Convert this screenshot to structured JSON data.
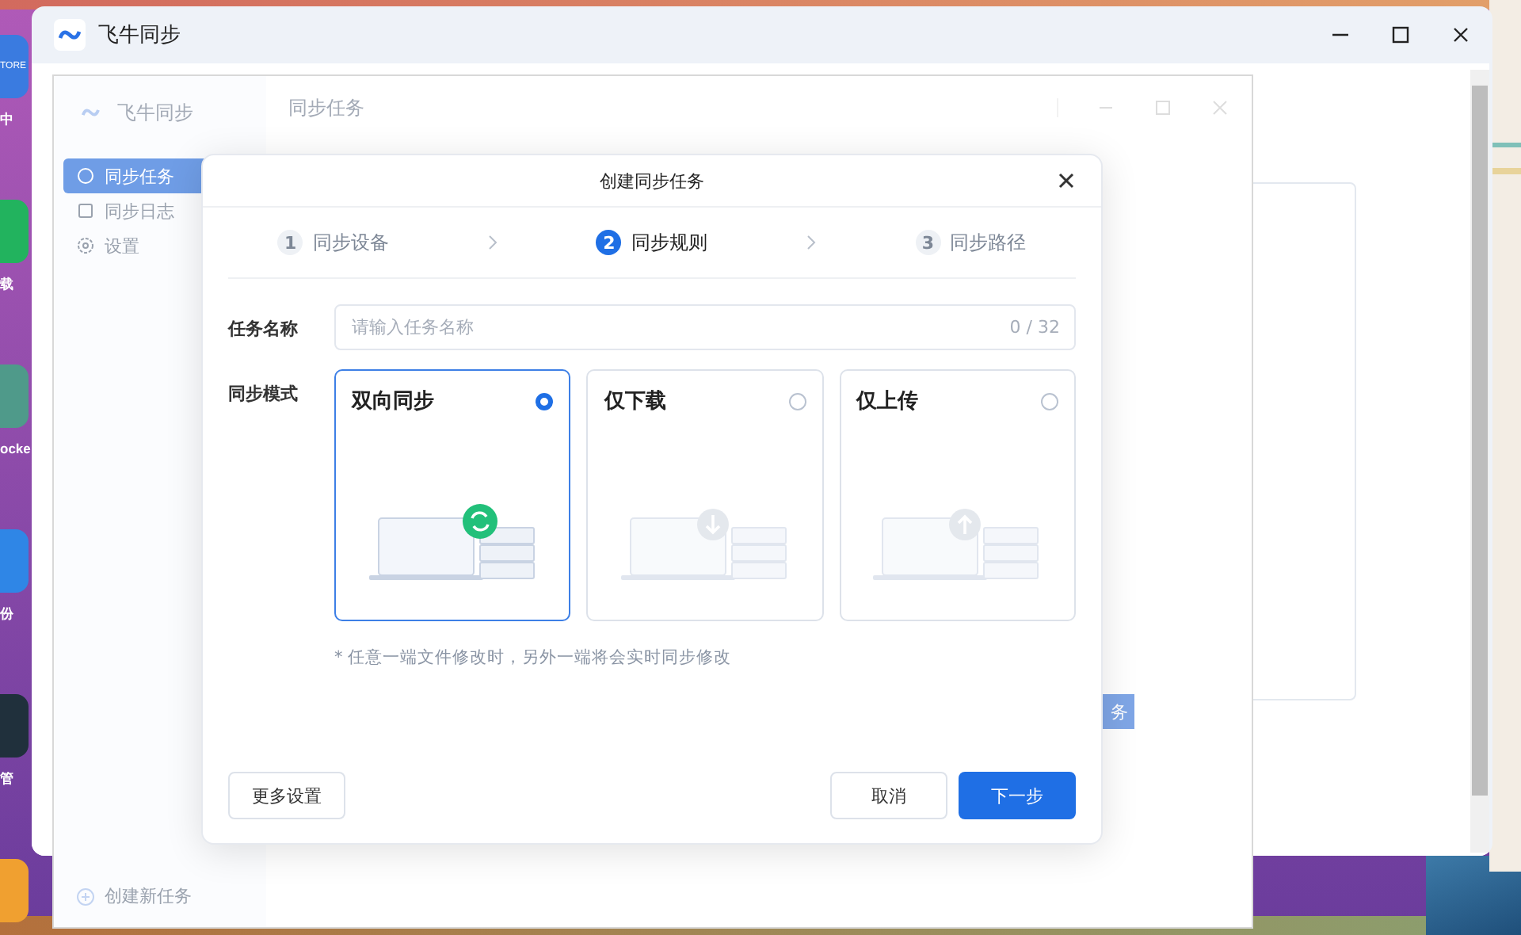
{
  "desktop_icons": [
    {
      "icon_text": "TORE",
      "label": "中",
      "color": "#3a7be0"
    },
    {
      "label": "载",
      "color": "#22b35e"
    },
    {
      "label": "ocke",
      "color": "#4f9a8a"
    },
    {
      "label": "份",
      "color": "#2f86e6"
    },
    {
      "label": "管",
      "color": "#20303c"
    },
    {
      "color": "#f0a030"
    }
  ],
  "app_window": {
    "title": "飞牛同步"
  },
  "main_window": {
    "app_name": "飞牛同步",
    "header": "同步任务",
    "nav": [
      {
        "label": "同步任务",
        "selected": true
      },
      {
        "label": "同步日志",
        "selected": false
      },
      {
        "label": "设置",
        "selected": false
      }
    ],
    "create_task": "创建新任务",
    "button_fragment": "务"
  },
  "dialog": {
    "title": "创建同步任务",
    "steps": [
      {
        "number": "1",
        "label": "同步设备",
        "selected": false
      },
      {
        "number": "2",
        "label": "同步规则",
        "selected": true
      },
      {
        "number": "3",
        "label": "同步路径",
        "selected": false
      }
    ],
    "task_name": {
      "label": "任务名称",
      "placeholder": "请输入任务名称",
      "counter": "0 / 32"
    },
    "mode": {
      "label": "同步模式",
      "options": [
        {
          "title": "双向同步",
          "kind": "sync",
          "selected": true
        },
        {
          "title": "仅下载",
          "kind": "download",
          "selected": false
        },
        {
          "title": "仅上传",
          "kind": "upload",
          "selected": false
        }
      ]
    },
    "hint": "* 任意一端文件修改时，另外一端将会实时同步修改",
    "buttons": {
      "more": "更多设置",
      "cancel": "取消",
      "next": "下一步"
    }
  }
}
